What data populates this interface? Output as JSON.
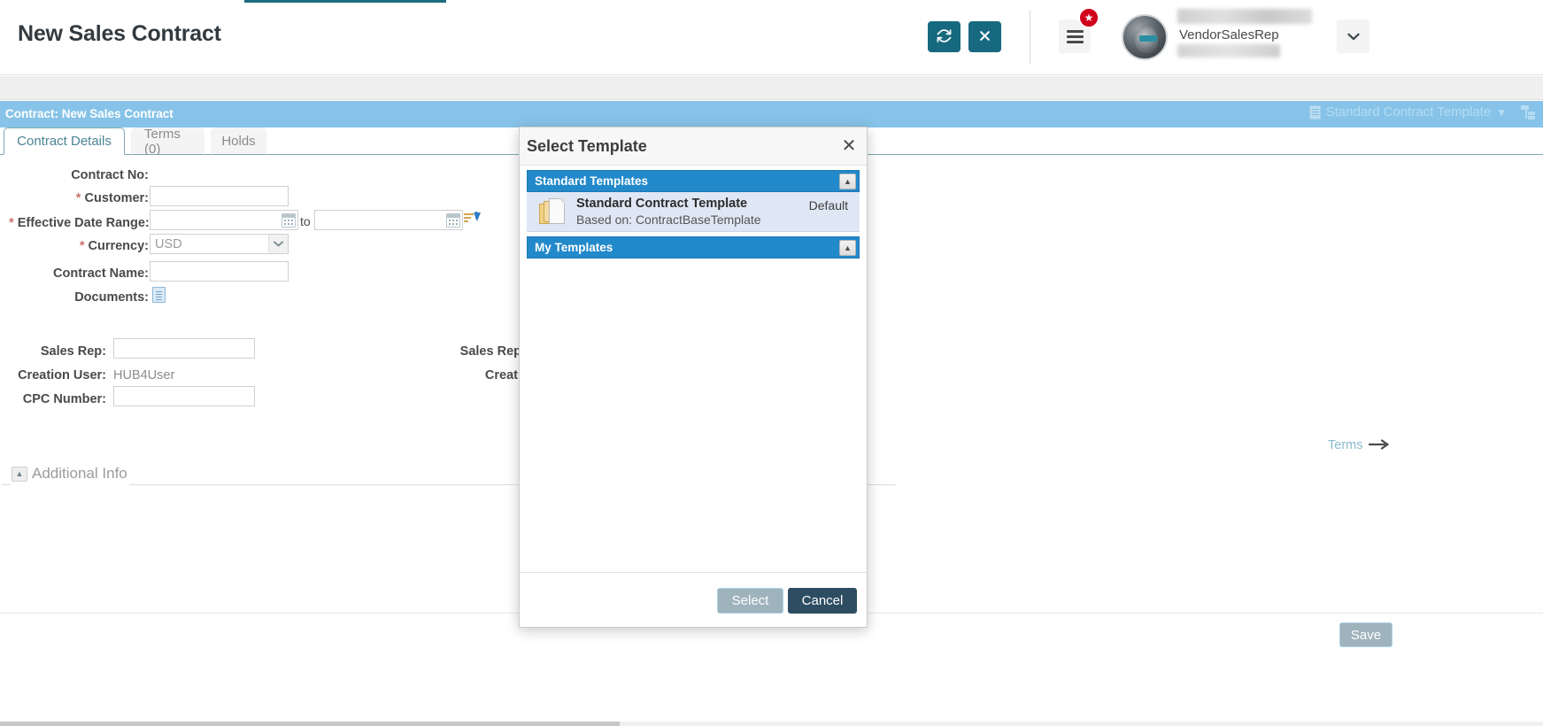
{
  "header": {
    "page_title": "New Sales Contract",
    "refresh_icon": "refresh-icon",
    "close_icon": "close-icon",
    "menu_icon": "hamburger-menu-icon",
    "star_badge_icon": "star-icon",
    "star_badge_glyph": "★",
    "avatar_icon": "user-avatar",
    "user_role": "VendorSalesRep",
    "user_caret_glyph": "⌄",
    "accent_teal": "#16697f",
    "badge_red": "#d0021b"
  },
  "contract_bar": {
    "title": "Contract: New Sales Contract",
    "template_name": "Standard Contract Template",
    "template_doc_icon": "document-icon",
    "caret_glyph": "▼",
    "tree_icon": "template-tree-icon",
    "bg_color": "#87c3e8"
  },
  "tabs": [
    {
      "label": "Contract Details",
      "active": true
    },
    {
      "label": "Terms (0)",
      "active": false
    },
    {
      "label": "Holds",
      "active": false
    }
  ],
  "form": {
    "fields": {
      "contract_no": {
        "label": "Contract No:",
        "required": false,
        "value": ""
      },
      "customer": {
        "label": "Customer:",
        "required": true,
        "value": ""
      },
      "effective_date_range": {
        "label": "Effective Date Range:",
        "required": true,
        "from_value": "",
        "to_value": "",
        "separator": "to",
        "calendar_icon": "calendar-icon",
        "sort_icon": "sort-filter-icon"
      },
      "currency": {
        "label": "Currency:",
        "required": true,
        "value": "USD",
        "options": [
          "USD"
        ]
      },
      "contract_name": {
        "label": "Contract Name:",
        "required": false,
        "value": ""
      },
      "documents": {
        "label": "Documents:",
        "required": false,
        "attach_icon": "document-attach-icon"
      }
    },
    "additional_info": {
      "legend": "Additional Info",
      "collapse_glyph": "▲",
      "fields": {
        "sales_rep": {
          "label": "Sales Rep:",
          "value": ""
        },
        "creation_user": {
          "label": "Creation User:",
          "value": "HUB4User"
        },
        "cpc_number": {
          "label": "CPC Number:",
          "value": ""
        },
        "sales_rep_right": {
          "label": "Sales Rep"
        },
        "creation_right": {
          "label": "Creati"
        }
      }
    },
    "required_marker": "*",
    "required_color": "#c9726f"
  },
  "terms_link": {
    "label": "Terms",
    "arrow_glyph": "⟹",
    "arrow_icon": "arrow-right-icon"
  },
  "footer": {
    "save_label": "Save"
  },
  "modal": {
    "title": "Select Template",
    "close_glyph": "✕",
    "groups": [
      {
        "label": "Standard Templates",
        "collapse_glyph": "▲",
        "items": [
          {
            "name": "Standard Contract Template",
            "subtitle": "Based on: ContractBaseTemplate",
            "badge": "Default",
            "icon": "template-pages-icon"
          }
        ]
      },
      {
        "label": "My Templates",
        "collapse_glyph": "▲",
        "items": []
      }
    ],
    "buttons": {
      "select_label": "Select",
      "cancel_label": "Cancel"
    },
    "group_header_color": "#2289ca",
    "item_bg_color": "#dfe7f5"
  }
}
